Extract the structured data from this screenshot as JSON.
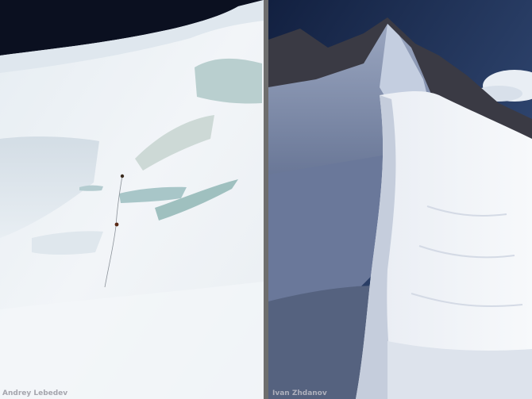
{
  "left_photo": {
    "credit": "Andrey Lebedev",
    "colors": {
      "sky": "#0b1020",
      "snow": "#eef2f6",
      "shadow": "#c9d4dd",
      "ice": "#9fc0bf"
    }
  },
  "right_photo": {
    "credit": "Ivan Zhdanov",
    "colors": {
      "sky": "#1a2c4f",
      "snow": "#f3f5f8",
      "shadow": "#7d8aa8",
      "rock": "#3a3a44"
    }
  }
}
